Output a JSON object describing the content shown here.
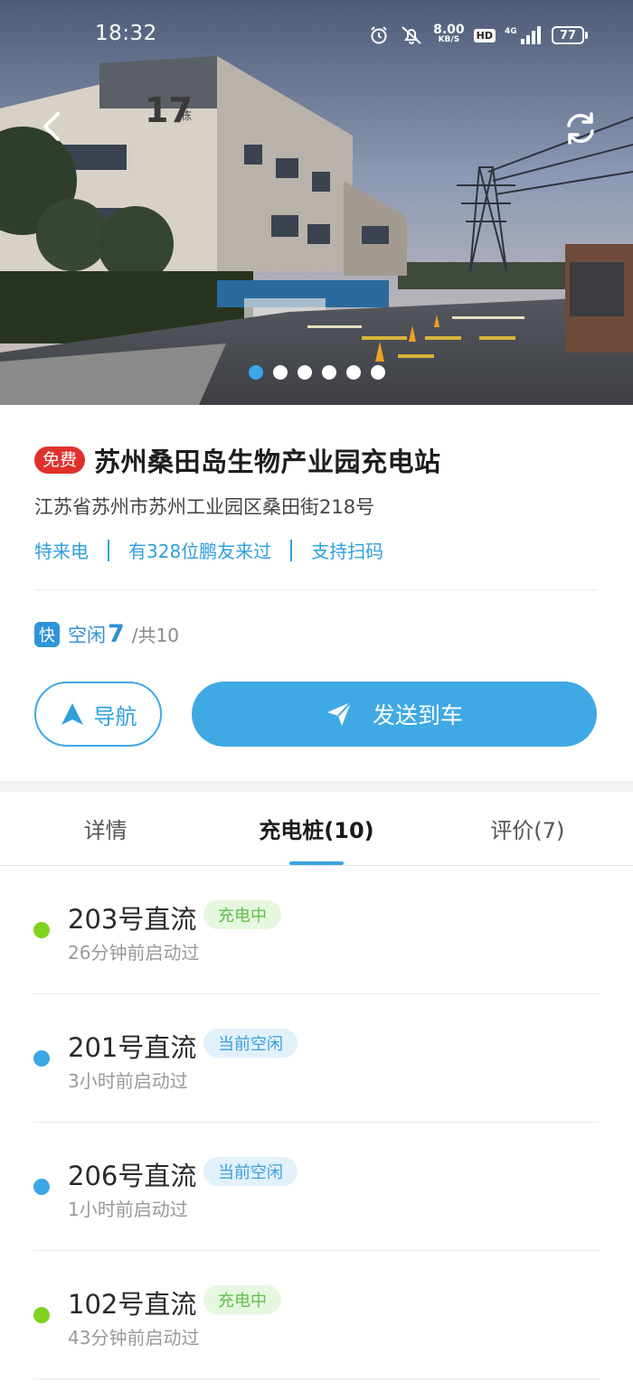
{
  "status_bar": {
    "time": "18:32",
    "net_speed_value": "8.00",
    "net_speed_unit": "KB/S",
    "hd_label": "HD",
    "network_label": "4G",
    "battery": "77"
  },
  "hero": {
    "building_sign": "17",
    "building_sign_suffix": "栋",
    "photo_count": 6,
    "active_photo_index": 0
  },
  "station": {
    "price_badge": "免费",
    "name": "苏州桑田岛生物产业园充电站",
    "address": "江苏省苏州市苏州工业园区桑田街218号",
    "tags": [
      "特来电",
      "有328位鹏友来过",
      "支持扫码"
    ],
    "fast_badge": "快",
    "available_label": "空闲",
    "available_count": "7",
    "total_label": "/共10"
  },
  "actions": {
    "navigate_label": "导航",
    "send_to_car_label": "发送到车"
  },
  "tabs": [
    {
      "label": "详情",
      "active": false
    },
    {
      "label": "充电桩(10)",
      "active": true
    },
    {
      "label": "评价(7)",
      "active": false
    }
  ],
  "piles": [
    {
      "name": "203号直流",
      "status": "充电中",
      "status_type": "charging",
      "last_start": "26分钟前启动过"
    },
    {
      "name": "201号直流",
      "status": "当前空闲",
      "status_type": "idle",
      "last_start": "3小时前启动过"
    },
    {
      "name": "206号直流",
      "status": "当前空闲",
      "status_type": "idle",
      "last_start": "1小时前启动过"
    },
    {
      "name": "102号直流",
      "status": "充电中",
      "status_type": "charging",
      "last_start": "43分钟前启动过"
    }
  ],
  "colors": {
    "accent": "#3fa9e4",
    "free_badge": "#e0302c",
    "charging_dot": "#7ed321",
    "idle_dot": "#3ba7e6"
  }
}
